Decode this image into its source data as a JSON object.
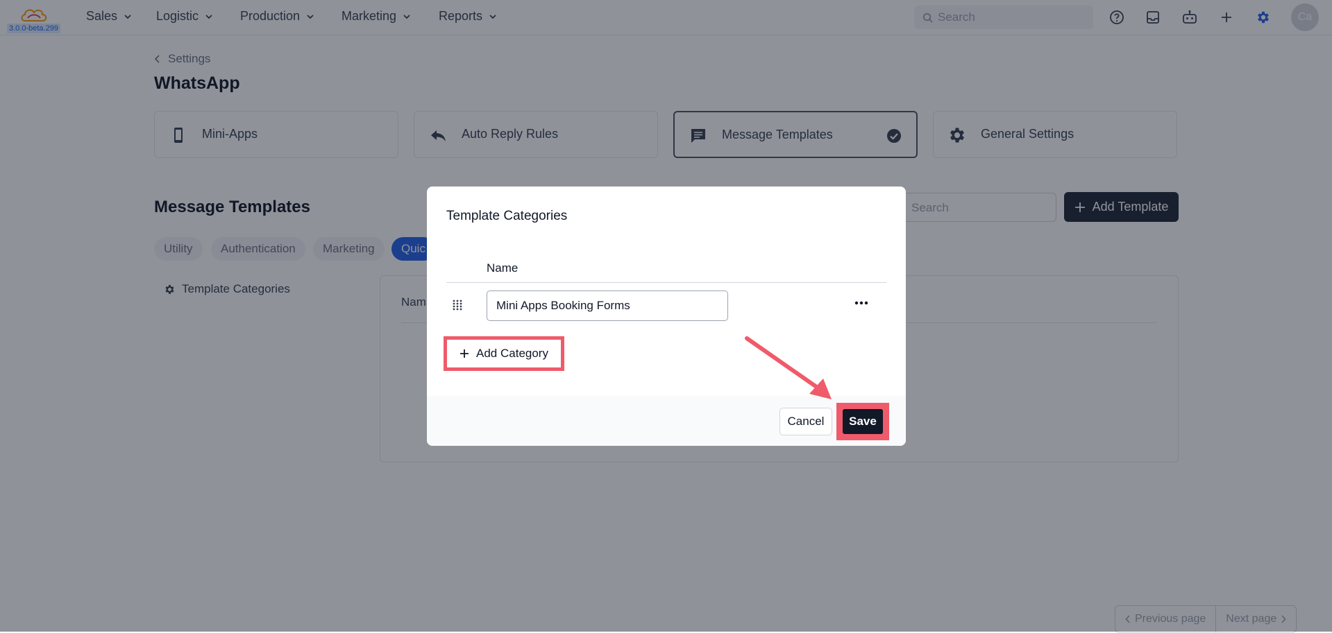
{
  "app": {
    "version": "3.0.0-beta.299",
    "avatar_initials": "Ca",
    "search_placeholder": "Search",
    "accent_color": "#2563eb"
  },
  "nav": {
    "items": [
      {
        "label": "Sales"
      },
      {
        "label": "Logistic"
      },
      {
        "label": "Production"
      },
      {
        "label": "Marketing"
      },
      {
        "label": "Reports"
      }
    ]
  },
  "breadcrumb": {
    "label": "Settings"
  },
  "page": {
    "title": "WhatsApp"
  },
  "cards": [
    {
      "label": "Mini-Apps",
      "icon": "phone-icon"
    },
    {
      "label": "Auto Reply Rules",
      "icon": "reply-icon"
    },
    {
      "label": "Message Templates",
      "icon": "message-icon",
      "active": true
    },
    {
      "label": "General Settings",
      "icon": "gear-icon"
    }
  ],
  "templates": {
    "title": "Message Templates",
    "search_placeholder": "Search",
    "add_button": "Add Template",
    "tabs": [
      "Utility",
      "Authentication",
      "Marketing",
      "Quic"
    ],
    "side_link": "Template Categories",
    "table_header": "Nam",
    "pager": {
      "prev": "Previous page",
      "next": "Next page"
    }
  },
  "modal": {
    "title": "Template Categories",
    "column_header": "Name",
    "rows": [
      {
        "name": "Mini Apps Booking Forms"
      }
    ],
    "add_category": "Add Category",
    "cancel": "Cancel",
    "save": "Save",
    "highlight_color": "#ef5b6a"
  }
}
